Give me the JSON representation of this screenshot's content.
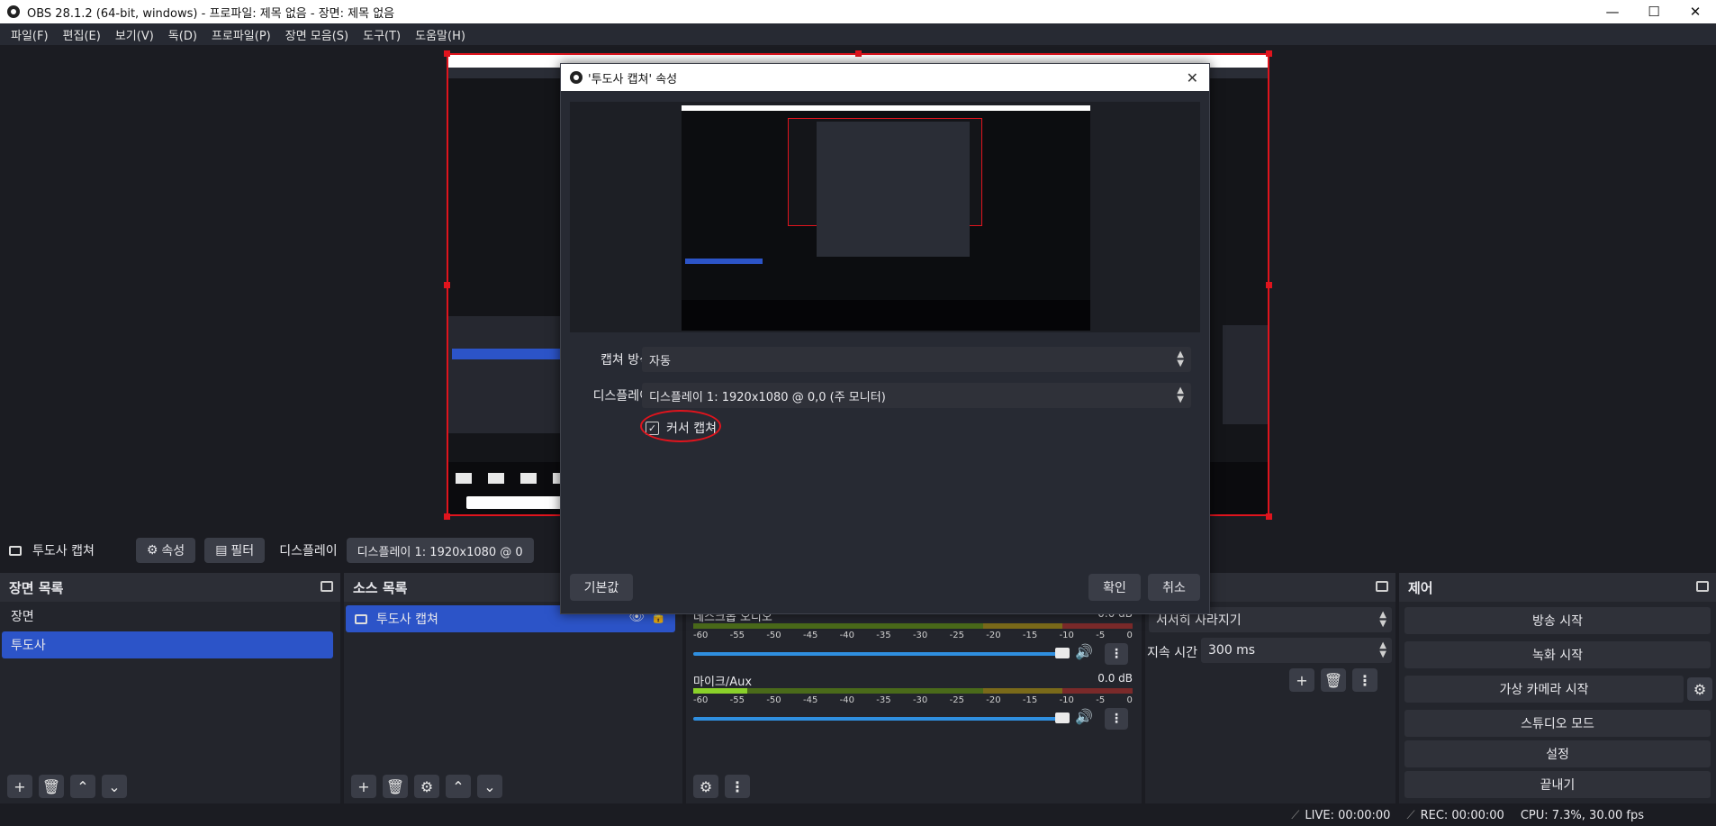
{
  "window": {
    "title": "OBS 28.1.2 (64-bit, windows) - 프로파일: 제목 없음 - 장면: 제목 없음",
    "minimize": "—",
    "maximize": "☐",
    "close": "✕"
  },
  "menu": {
    "items": [
      "파일(F)",
      "편집(E)",
      "보기(V)",
      "독(D)",
      "프로파일(P)",
      "장면 모음(S)",
      "도구(T)",
      "도움말(H)"
    ]
  },
  "source_toolbar": {
    "source_name": "투도사 캡쳐",
    "properties_label": "속성",
    "filters_label": "필터",
    "display_label": "디스플레이",
    "display_value": "디스플레이 1: 1920x1080 @ 0"
  },
  "scenes": {
    "header": "장면 목록",
    "items": [
      "장면",
      "투도사"
    ],
    "selected_index": 1
  },
  "sources": {
    "header": "소스 목록",
    "items": [
      "투도사 캡쳐"
    ]
  },
  "mixer": {
    "tracks": [
      {
        "name": "데스크톱 오디오",
        "db": "0.0 dB"
      },
      {
        "name": "마이크/Aux",
        "db": "0.0 dB"
      }
    ],
    "scale": [
      "-60",
      "-55",
      "-50",
      "-45",
      "-40",
      "-35",
      "-30",
      "-25",
      "-20",
      "-15",
      "-10",
      "-5",
      "0"
    ]
  },
  "transitions": {
    "transition_value": "서서히 사라지기",
    "duration_label": "지속 시간",
    "duration_value": "300 ms"
  },
  "controls": {
    "header": "제어",
    "buttons": [
      "방송 시작",
      "녹화 시작",
      "가상 카메라 시작",
      "스튜디오 모드",
      "설정",
      "끝내기"
    ]
  },
  "status": {
    "live": "LIVE: 00:00:00",
    "rec": "REC: 00:00:00",
    "cpu": "CPU: 7.3%, 30.00 fps"
  },
  "dialog": {
    "title": "'투도사 캡쳐' 속성",
    "capture_method_label": "캡쳐 방식",
    "capture_method_value": "자동",
    "display_label": "디스플레이",
    "display_value": "디스플레이 1: 1920x1080 @ 0,0 (주 모니터)",
    "cursor_label": "커서 캡쳐",
    "cursor_checked": true,
    "defaults_button": "기본값",
    "ok_button": "확인",
    "cancel_button": "취소"
  },
  "colors": {
    "selection": "#2c54c8",
    "capture_border": "#e0141d",
    "volume_slider": "#2f8fe0"
  }
}
